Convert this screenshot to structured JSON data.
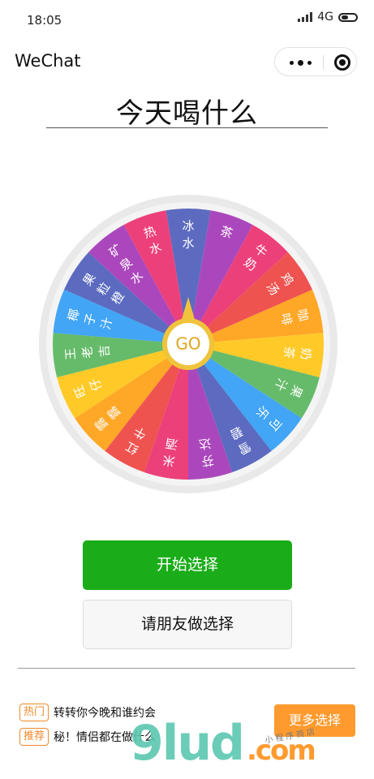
{
  "status_bar": {
    "time": "18:05",
    "network": "4G"
  },
  "nav": {
    "title": "WeChat",
    "more_icon": "more-dots-icon",
    "close_icon": "target-close-icon"
  },
  "page": {
    "title": "今天喝什么"
  },
  "wheel": {
    "center_label": "GO",
    "segments": [
      {
        "label": "冰水",
        "color": "#5C6BC0"
      },
      {
        "label": "茶",
        "color": "#AB47BC"
      },
      {
        "label": "牛奶",
        "color": "#EC407A"
      },
      {
        "label": "鸡汤",
        "color": "#EF5350"
      },
      {
        "label": "咖啡",
        "color": "#FFA726"
      },
      {
        "label": "奶茶",
        "color": "#FFCA28"
      },
      {
        "label": "果汁",
        "color": "#66BB6A"
      },
      {
        "label": "可乐",
        "color": "#42A5F5"
      },
      {
        "label": "雪碧",
        "color": "#5C6BC0"
      },
      {
        "label": "芬达",
        "color": "#AB47BC"
      },
      {
        "label": "米酒",
        "color": "#EC407A"
      },
      {
        "label": "红牛",
        "color": "#EF5350"
      },
      {
        "label": "露露",
        "color": "#FFA726"
      },
      {
        "label": "旺仔",
        "color": "#FFCA28"
      },
      {
        "label": "王老吉",
        "color": "#66BB6A"
      },
      {
        "label": "椰子汁",
        "color": "#42A5F5"
      },
      {
        "label": "果粒橙",
        "color": "#5C6BC0"
      },
      {
        "label": "矿泉水",
        "color": "#AB47BC"
      },
      {
        "label": "热水",
        "color": "#EC407A"
      }
    ]
  },
  "buttons": {
    "start": "开始选择",
    "friend": "请朋友做选择"
  },
  "recommend": [
    {
      "tag": "热门",
      "text": "转转你今晚和谁约会"
    },
    {
      "tag": "推荐",
      "text": "秘！情侣都在做什么"
    }
  ],
  "more_button": "更多选择",
  "watermark": {
    "main": "9lud",
    "com": ".com",
    "small": "小程序商店"
  }
}
